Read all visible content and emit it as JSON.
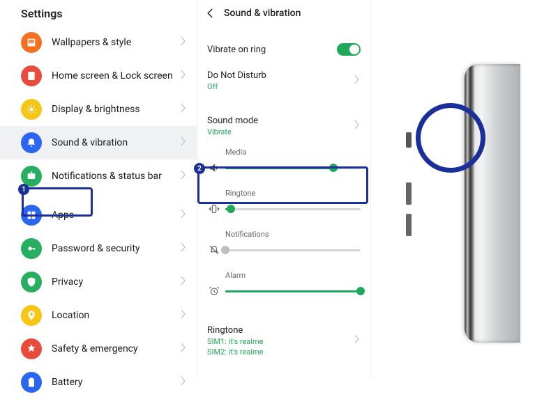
{
  "settings": {
    "title": "Settings",
    "items": [
      {
        "label": "Wallpapers & style",
        "icon": "wallpaper-icon",
        "color": "icon-orange"
      },
      {
        "label": "Home screen & Lock screen",
        "icon": "home-lock-icon",
        "color": "icon-red"
      },
      {
        "label": "Display & brightness",
        "icon": "brightness-icon",
        "color": "icon-yellow"
      },
      {
        "label": "Sound & vibration",
        "icon": "sound-icon",
        "color": "icon-blue",
        "active": true
      },
      {
        "label": "Notifications & status bar",
        "icon": "notification-icon",
        "color": "icon-green"
      },
      {
        "label": "Apps",
        "icon": "apps-icon",
        "color": "icon-blue"
      },
      {
        "label": "Password & security",
        "icon": "lock-icon",
        "color": "icon-green"
      },
      {
        "label": "Privacy",
        "icon": "privacy-icon",
        "color": "icon-green"
      },
      {
        "label": "Location",
        "icon": "location-icon",
        "color": "icon-yellow"
      },
      {
        "label": "Safety & emergency",
        "icon": "emergency-icon",
        "color": "icon-red"
      },
      {
        "label": "Battery",
        "icon": "battery-icon",
        "color": "icon-blue"
      }
    ]
  },
  "sound": {
    "header": "Sound & vibration",
    "vibrate_label": "Vibrate on ring",
    "vibrate_on": true,
    "dnd_label": "Do Not Disturb",
    "dnd_value": "Off",
    "sound_mode_label": "Sound mode",
    "sound_mode_value": "Vibrate",
    "sliders": {
      "media": {
        "label": "Media",
        "percent": 80
      },
      "ringtone": {
        "label": "Ringtone",
        "percent": 4
      },
      "notifications": {
        "label": "Notifications",
        "percent": 0
      },
      "alarm": {
        "label": "Alarm",
        "percent": 100
      }
    },
    "ringtone_section": {
      "title": "Ringtone",
      "sim1": "SIM1: it's realme",
      "sim2": "SIM2: it's realme"
    }
  },
  "callouts": {
    "1": "1",
    "2": "2"
  }
}
